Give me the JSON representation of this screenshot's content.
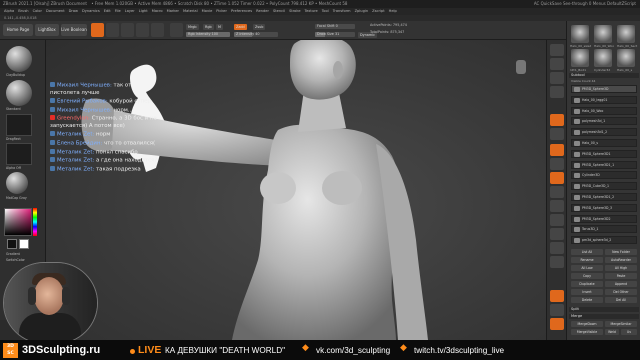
{
  "titlebar": {
    "title": "ZBrush 2021.1 [Olsahj]  ZBrush Document",
    "stats": "• Free Mem 1.020GB • Active Mem 4866 • Scratch Disk 80 • ZTime 1.052 Timer 0.022 • PolyCount 798.412 KP • MeshCount 58",
    "right": "AC   QuickSave   See-through 0   Menus   DefaultZScript"
  },
  "menubar": {
    "items": [
      "Alpha",
      "Brush",
      "Color",
      "Document",
      "Draw",
      "Dynamics",
      "Edit",
      "File",
      "Layer",
      "Light",
      "Macro",
      "Marker",
      "Material",
      "Movie",
      "Picker",
      "Preferences",
      "Render",
      "Stencil",
      "Stroke",
      "Texture",
      "Tool",
      "Transform",
      "Zplugin",
      "Zscript",
      "Help"
    ]
  },
  "infobar": {
    "text": "0.141,-0.458,0.018"
  },
  "toptray": {
    "home": "Home Page",
    "lightbox": "LightBox",
    "boolean": "Live Boolean",
    "edit": "Edit",
    "draw": "Draw",
    "move": "Move",
    "scale": "Scale",
    "rotate": "Rotate",
    "mrgb": "Mrgb",
    "rgb": "Rgb",
    "m": "M",
    "zadd": "Zadd",
    "zsub": "Zsub",
    "zcut": "Zcut",
    "focal_label": "Focal Shift",
    "focal_value": "0",
    "draw_label": "Draw Size",
    "draw_value": "31",
    "dynamic": "Dynamic",
    "rgb_intensity": "Rgb Intensity 100",
    "z_intensity": "Z Intensity 40",
    "active_points": "ActivePoints: 795,474",
    "total_points": "TotalPoints: 875,347"
  },
  "leftshelf": {
    "brush1": "ClayBuildup",
    "brush2": "Standard",
    "stroke": "DragRect",
    "alpha": "Alpha Off",
    "texture": "Texture Off",
    "material": "MatCap Gray",
    "gradient": "Gradient",
    "switch": "SwitchColor",
    "alternate": "Alternate"
  },
  "chat": [
    {
      "src": "vk",
      "name": "Михаил Чернышев:",
      "name_class": "",
      "text": "так от пистолета лучше"
    },
    {
      "src": "vk",
      "name": "Евгений Рыбаков:",
      "name_class": "",
      "text": "кобурой супер"
    },
    {
      "src": "vk",
      "name": "Михаил Чернышев:",
      "name_class": "",
      "text": "норм...."
    },
    {
      "src": "yt",
      "name": "Greendylon:",
      "name_class": "red",
      "text": "Странно, а 3D бос и не запускается) А потом все)"
    },
    {
      "src": "vk",
      "name": "Металик Zet:",
      "name_class": "",
      "text": "норм"
    },
    {
      "src": "vk",
      "name": "Елена Брейдин:",
      "name_class": "",
      "text": "что то отвалился("
    },
    {
      "src": "vk",
      "name": "Металик Zet:",
      "name_class": "",
      "text": "понял спасибо"
    },
    {
      "src": "vk",
      "name": "Металик Zet:",
      "name_class": "",
      "text": "а где она находится?"
    },
    {
      "src": "vk",
      "name": "Металик Zet:",
      "name_class": "",
      "text": "такая подрезка"
    }
  ],
  "rightpanel": {
    "thumbs": [
      "Halo_00_sized",
      "Halo_00_Woo",
      "Halo_00_Sect",
      "1Pr1_Bod1",
      "Cylinder3d",
      "Halo_00_s"
    ],
    "subtool_header": "Subtool",
    "visible_count": "Visible Count 44",
    "subtools": [
      "PM3D_Sphere3D",
      "Halo_00_legg01",
      "Halo_00_Woo",
      "polymesh3d_1",
      "polymesh3d1_2",
      "Halo_00_s",
      "PM3D_Sphere3D1",
      "PM3D_Sphere3D1_1",
      "Cylinder3D",
      "PM3D_Cube3D_1",
      "PM3D_Sphere3D1_2",
      "PM3D_Sphere3D_3",
      "PM3D_Sphere3D2",
      "Torus3D_1",
      "pm3d_sphere3d_2"
    ],
    "list_all": "List All",
    "new_folder": "New Folder",
    "rename": "Rename",
    "auto_reorder": "AutoReorder",
    "all_low": "All Low",
    "all_high": "All High",
    "copy": "Copy",
    "paste": "Paste",
    "duplicate": "Duplicate",
    "append": "Append",
    "insert": "Insert",
    "del_other": "Del Other",
    "delete": "Delete",
    "del_all": "Del All",
    "split": "Split",
    "merge": "Merge",
    "merge_down": "MergeDown",
    "merge_similar": "MergeSimilar",
    "merge_visible": "MergeVisible",
    "weld": "Weld",
    "uv": "Uv"
  },
  "footer": {
    "badge_top": "3D",
    "badge_bottom": "SC",
    "brand": "3DSculpting.ru",
    "live": "LIVE",
    "title": "КА ДЕВУШКИ \"DEATH WORLD\"",
    "vk": "vk.com/3d_sculpting",
    "twitch": "twitch.tv/3dsculpting_live"
  },
  "colors": {
    "accent": "#e0681c",
    "footer_orange": "#ff8c1a"
  }
}
